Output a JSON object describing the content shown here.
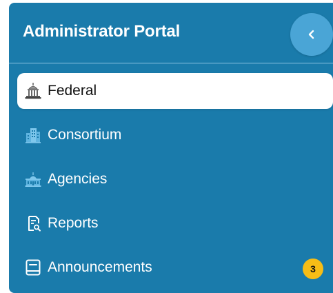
{
  "header": {
    "title": "Administrator Portal",
    "collapse_icon": "chevron-left-icon"
  },
  "nav": {
    "items": [
      {
        "label": "Federal",
        "icon": "capitol-building-icon",
        "active": true
      },
      {
        "label": "Consortium",
        "icon": "office-buildings-icon",
        "active": false
      },
      {
        "label": "Agencies",
        "icon": "government-building-icon",
        "active": false
      },
      {
        "label": "Reports",
        "icon": "report-search-icon",
        "active": false
      },
      {
        "label": "Announcements",
        "icon": "announcement-book-icon",
        "active": false,
        "badge": "3"
      }
    ]
  },
  "colors": {
    "sidebar_bg": "#1a7bab",
    "collapse_button_bg": "#4aa5d6",
    "active_item_bg": "#ffffff",
    "badge_bg": "#f7bd16",
    "icon_inactive": "#7ec7ec"
  }
}
